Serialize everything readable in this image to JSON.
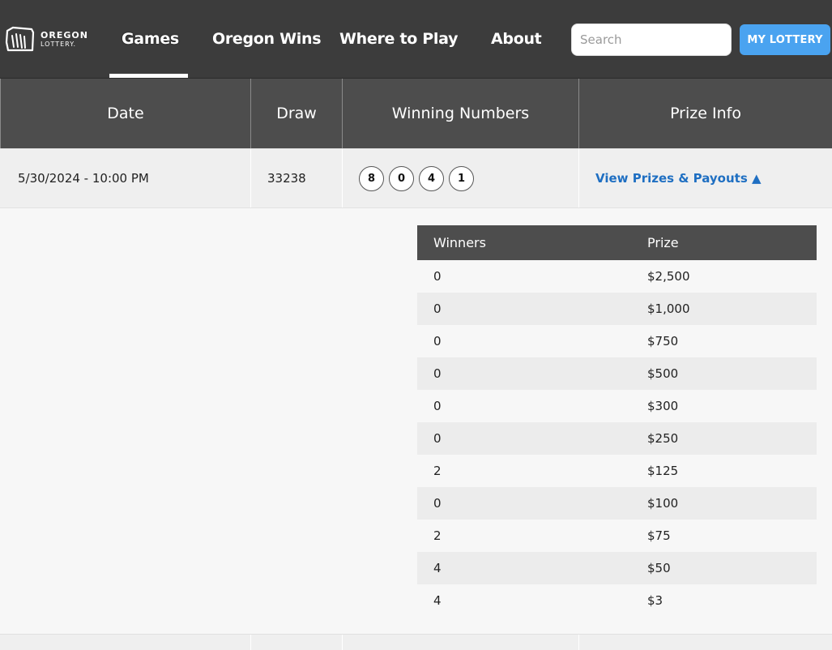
{
  "header": {
    "logo": {
      "line1": "OREGON",
      "line2": "LOTTERY."
    },
    "nav": {
      "games": "Games",
      "oregon_wins": "Oregon Wins",
      "where_to_play": "Where to Play",
      "about": "About"
    },
    "search": {
      "placeholder": "Search",
      "value": ""
    },
    "my_lottery": "MY LOTTERY"
  },
  "results_table": {
    "headers": {
      "date": "Date",
      "draw": "Draw",
      "numbers": "Winning Numbers",
      "prize": "Prize Info"
    },
    "row": {
      "date": "5/30/2024 - 10:00 PM",
      "draw": "33238",
      "numbers": [
        "8",
        "0",
        "4",
        "1"
      ],
      "prize_link": "View Prizes & Payouts ▲"
    }
  },
  "prize_table": {
    "headers": {
      "winners": "Winners",
      "prize": "Prize"
    },
    "rows": [
      {
        "winners": "0",
        "prize": "$2,500"
      },
      {
        "winners": "0",
        "prize": "$1,000"
      },
      {
        "winners": "0",
        "prize": "$750"
      },
      {
        "winners": "0",
        "prize": "$500"
      },
      {
        "winners": "0",
        "prize": "$300"
      },
      {
        "winners": "0",
        "prize": "$250"
      },
      {
        "winners": "2",
        "prize": "$125"
      },
      {
        "winners": "0",
        "prize": "$100"
      },
      {
        "winners": "2",
        "prize": "$75"
      },
      {
        "winners": "4",
        "prize": "$50"
      },
      {
        "winners": "4",
        "prize": "$3"
      }
    ]
  },
  "colors": {
    "header_bg": "#3c3c3c",
    "table_header_bg": "#4d4d4d",
    "link": "#1f6fc2",
    "button": "#4aa3f0"
  }
}
